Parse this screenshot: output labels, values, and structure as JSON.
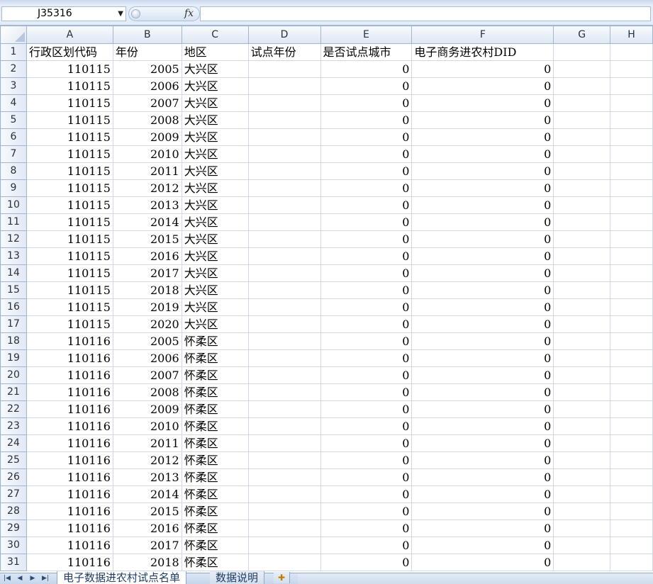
{
  "name_box": {
    "value": "J35316"
  },
  "formula_bar": {
    "fx_label": "fx",
    "content": ""
  },
  "columns": [
    "A",
    "B",
    "C",
    "D",
    "E",
    "F",
    "G",
    "H"
  ],
  "header_row": {
    "row": "1",
    "cells": [
      "行政区划代码",
      "年份",
      "地区",
      "试点年份",
      "是否试点城市",
      "电子商务进农村DID",
      "",
      ""
    ]
  },
  "rows": [
    {
      "row": "2",
      "a": "110115",
      "b": "2005",
      "c": "大兴区",
      "d": "",
      "e": "0",
      "f": "0"
    },
    {
      "row": "3",
      "a": "110115",
      "b": "2006",
      "c": "大兴区",
      "d": "",
      "e": "0",
      "f": "0"
    },
    {
      "row": "4",
      "a": "110115",
      "b": "2007",
      "c": "大兴区",
      "d": "",
      "e": "0",
      "f": "0"
    },
    {
      "row": "5",
      "a": "110115",
      "b": "2008",
      "c": "大兴区",
      "d": "",
      "e": "0",
      "f": "0"
    },
    {
      "row": "6",
      "a": "110115",
      "b": "2009",
      "c": "大兴区",
      "d": "",
      "e": "0",
      "f": "0"
    },
    {
      "row": "7",
      "a": "110115",
      "b": "2010",
      "c": "大兴区",
      "d": "",
      "e": "0",
      "f": "0"
    },
    {
      "row": "8",
      "a": "110115",
      "b": "2011",
      "c": "大兴区",
      "d": "",
      "e": "0",
      "f": "0"
    },
    {
      "row": "9",
      "a": "110115",
      "b": "2012",
      "c": "大兴区",
      "d": "",
      "e": "0",
      "f": "0"
    },
    {
      "row": "10",
      "a": "110115",
      "b": "2013",
      "c": "大兴区",
      "d": "",
      "e": "0",
      "f": "0"
    },
    {
      "row": "11",
      "a": "110115",
      "b": "2014",
      "c": "大兴区",
      "d": "",
      "e": "0",
      "f": "0"
    },
    {
      "row": "12",
      "a": "110115",
      "b": "2015",
      "c": "大兴区",
      "d": "",
      "e": "0",
      "f": "0"
    },
    {
      "row": "13",
      "a": "110115",
      "b": "2016",
      "c": "大兴区",
      "d": "",
      "e": "0",
      "f": "0"
    },
    {
      "row": "14",
      "a": "110115",
      "b": "2017",
      "c": "大兴区",
      "d": "",
      "e": "0",
      "f": "0"
    },
    {
      "row": "15",
      "a": "110115",
      "b": "2018",
      "c": "大兴区",
      "d": "",
      "e": "0",
      "f": "0"
    },
    {
      "row": "16",
      "a": "110115",
      "b": "2019",
      "c": "大兴区",
      "d": "",
      "e": "0",
      "f": "0"
    },
    {
      "row": "17",
      "a": "110115",
      "b": "2020",
      "c": "大兴区",
      "d": "",
      "e": "0",
      "f": "0"
    },
    {
      "row": "18",
      "a": "110116",
      "b": "2005",
      "c": "怀柔区",
      "d": "",
      "e": "0",
      "f": "0"
    },
    {
      "row": "19",
      "a": "110116",
      "b": "2006",
      "c": "怀柔区",
      "d": "",
      "e": "0",
      "f": "0"
    },
    {
      "row": "20",
      "a": "110116",
      "b": "2007",
      "c": "怀柔区",
      "d": "",
      "e": "0",
      "f": "0"
    },
    {
      "row": "21",
      "a": "110116",
      "b": "2008",
      "c": "怀柔区",
      "d": "",
      "e": "0",
      "f": "0"
    },
    {
      "row": "22",
      "a": "110116",
      "b": "2009",
      "c": "怀柔区",
      "d": "",
      "e": "0",
      "f": "0"
    },
    {
      "row": "23",
      "a": "110116",
      "b": "2010",
      "c": "怀柔区",
      "d": "",
      "e": "0",
      "f": "0"
    },
    {
      "row": "24",
      "a": "110116",
      "b": "2011",
      "c": "怀柔区",
      "d": "",
      "e": "0",
      "f": "0"
    },
    {
      "row": "25",
      "a": "110116",
      "b": "2012",
      "c": "怀柔区",
      "d": "",
      "e": "0",
      "f": "0"
    },
    {
      "row": "26",
      "a": "110116",
      "b": "2013",
      "c": "怀柔区",
      "d": "",
      "e": "0",
      "f": "0"
    },
    {
      "row": "27",
      "a": "110116",
      "b": "2014",
      "c": "怀柔区",
      "d": "",
      "e": "0",
      "f": "0"
    },
    {
      "row": "28",
      "a": "110116",
      "b": "2015",
      "c": "怀柔区",
      "d": "",
      "e": "0",
      "f": "0"
    },
    {
      "row": "29",
      "a": "110116",
      "b": "2016",
      "c": "怀柔区",
      "d": "",
      "e": "0",
      "f": "0"
    },
    {
      "row": "30",
      "a": "110116",
      "b": "2017",
      "c": "怀柔区",
      "d": "",
      "e": "0",
      "f": "0"
    },
    {
      "row": "31",
      "a": "110116",
      "b": "2018",
      "c": "怀柔区",
      "d": "",
      "e": "0",
      "f": "0"
    }
  ],
  "sheet_tabs": [
    "电子数据进农村试点名单",
    "数据说明"
  ],
  "icons": {
    "nav": [
      "first-sheet-icon",
      "prev-sheet-icon",
      "next-sheet-icon",
      "last-sheet-icon"
    ],
    "new_sheet": "new-sheet-icon"
  }
}
